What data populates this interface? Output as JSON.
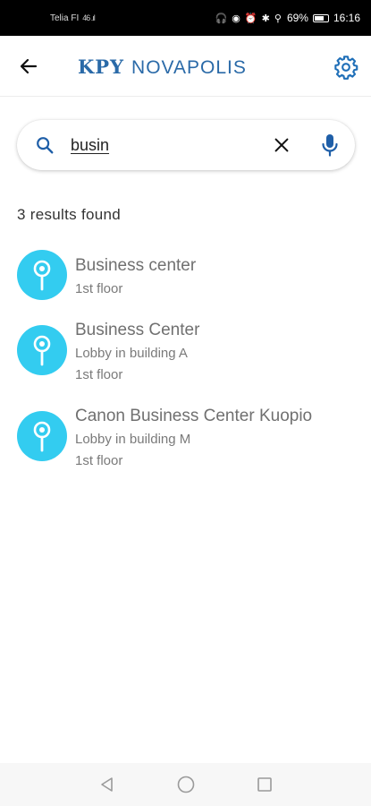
{
  "status_bar": {
    "carrier": "Telia FI",
    "signal": "46 .ıl",
    "icons": "🎧 ◉ ⏰ ✱ ⚲",
    "battery": "69%",
    "time": "16:16"
  },
  "app_bar": {
    "logo_kpy": "KPY",
    "logo_novapolis": "NOVAPOLIS"
  },
  "search": {
    "value": "busin"
  },
  "results_count": "3 results found",
  "results": [
    {
      "title": "Business center",
      "lines": [
        "1st floor"
      ]
    },
    {
      "title": "Business Center",
      "lines": [
        "Lobby in building A",
        "1st floor"
      ]
    },
    {
      "title": "Canon Business Center Kuopio",
      "lines": [
        "Lobby in building M",
        "1st floor"
      ]
    }
  ],
  "colors": {
    "brand": "#2a6aa8",
    "pin": "#33ccf0",
    "search_icon": "#1f5fa8"
  },
  "icons": {
    "back": "arrow-left",
    "settings": "gear",
    "search": "magnifier",
    "clear": "x",
    "mic": "microphone",
    "pin": "map-pin"
  }
}
